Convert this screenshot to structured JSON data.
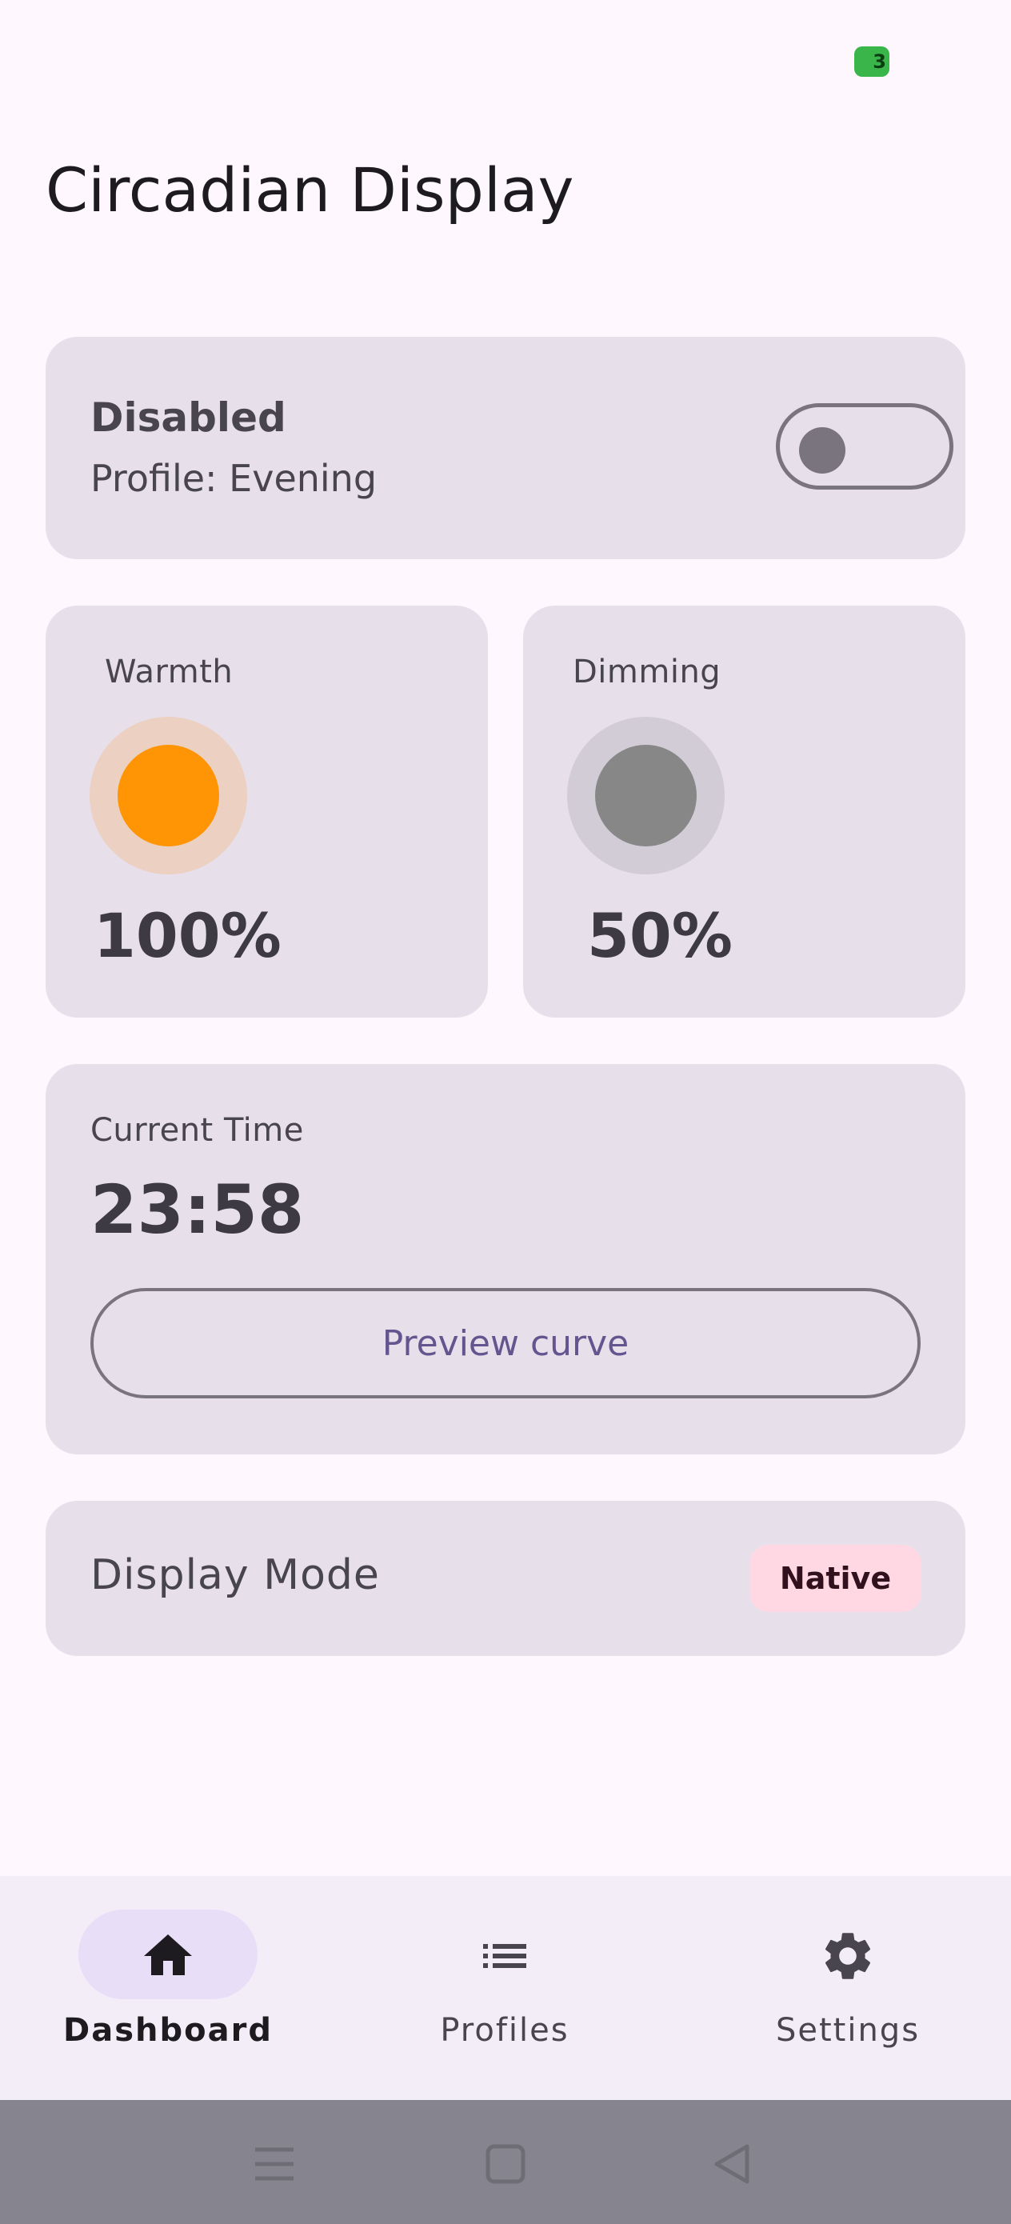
{
  "colors": {
    "background": "#fef7fd",
    "card": "#e7e0eb",
    "primary": "#65558f",
    "warmth_dot": "#ff9505",
    "dimming_dot": "#878787",
    "badge_bg": "#ffd8e4",
    "nav_bg": "#f3edf7",
    "nav_indicator": "#e8def8",
    "system_bar": "#86848e",
    "battery": "#3ab54a"
  },
  "status_bar": {
    "battery_text": "3"
  },
  "page": {
    "title": "Circadian Display"
  },
  "status": {
    "title": "Disabled",
    "profile": "Profile: Evening",
    "toggle_on": false
  },
  "warmth": {
    "label": "Warmth",
    "value": "100%",
    "level": 1.0
  },
  "dimming": {
    "label": "Dimming",
    "value": "50%",
    "level": 0.5
  },
  "time": {
    "label": "Current Time",
    "value": "23:58",
    "button_label": "Preview curve"
  },
  "display_mode": {
    "label": "Display Mode",
    "badge": "Native"
  },
  "bottom_nav": {
    "items": [
      {
        "label": "Dashboard",
        "icon": "home-icon",
        "selected": true
      },
      {
        "label": "Profiles",
        "icon": "list-icon",
        "selected": false
      },
      {
        "label": "Settings",
        "icon": "gear-icon",
        "selected": false
      }
    ]
  },
  "system_nav": {
    "icons": [
      "menu-icon",
      "home-square-icon",
      "back-triangle-icon"
    ]
  }
}
